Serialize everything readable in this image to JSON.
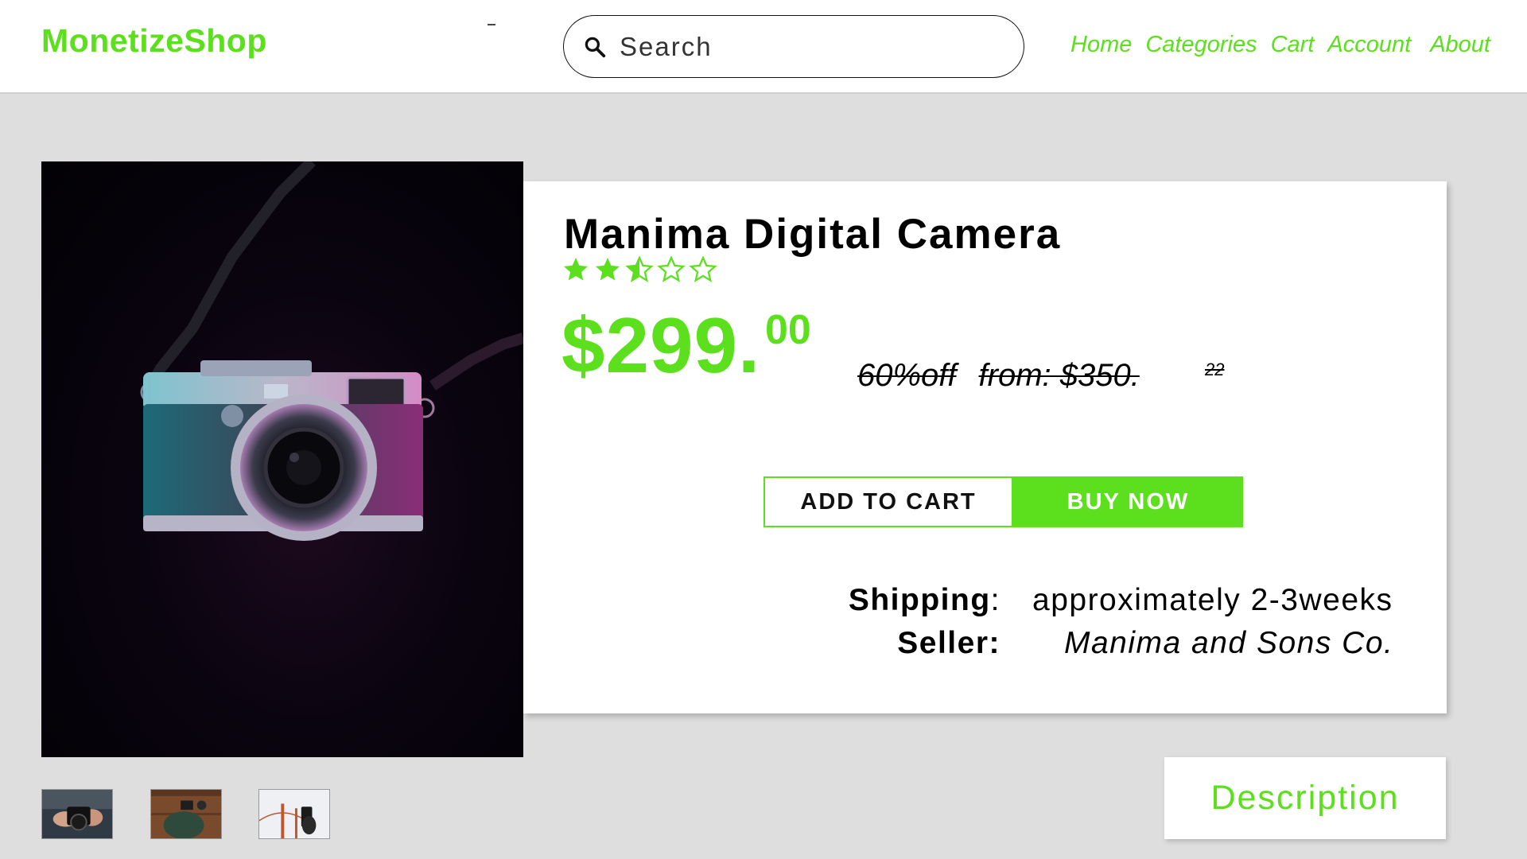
{
  "header": {
    "brand": "MonetizeShop",
    "search_placeholder": "Search",
    "nav": [
      "Home",
      "Categories",
      "Cart",
      "Account",
      "About"
    ]
  },
  "product": {
    "title": "Manima Digital Camera",
    "rating": 2.5,
    "rating_max": 5,
    "price_main": "$299.",
    "price_cents": "00",
    "discount": "60%off",
    "old_price": "from: $350.",
    "old_price_cents": "22",
    "add_to_cart_label": "ADD TO CART",
    "buy_now_label": "BUY NOW",
    "shipping_label": "Shipping",
    "shipping_value": "approximately 2-3weeks",
    "seller_label": "Seller:",
    "seller_value": "Manima and Sons Co."
  },
  "gallery": {
    "main_image": "camera-photo",
    "thumbnails": [
      "hands-holding-camera",
      "camera-on-wooden-table",
      "phone-photo-of-bridge"
    ]
  },
  "tabs": {
    "description_label": "Description"
  },
  "colors": {
    "accent": "#5ce01e",
    "background": "#dedede",
    "card": "#ffffff"
  }
}
